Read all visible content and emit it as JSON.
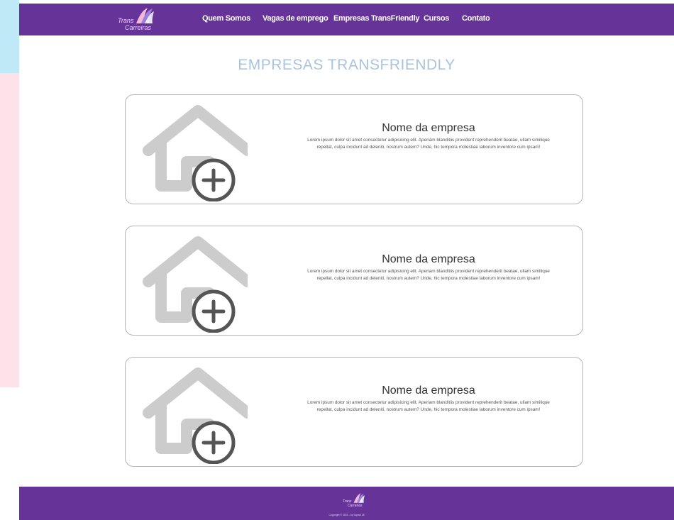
{
  "brand": {
    "line1": "Trans",
    "line2": "Carreiras"
  },
  "nav": {
    "items": [
      {
        "label": "Quem Somos"
      },
      {
        "label": "Vagas de emprego"
      },
      {
        "label": "Empresas TransFriendly"
      },
      {
        "label": "Cursos"
      },
      {
        "label": "Contato"
      }
    ]
  },
  "page": {
    "title": "EMPRESAS TRANSFRIENDLY"
  },
  "companies": [
    {
      "name": "Nome da empresa",
      "description": "Lorem ipsum dolor sit amet consectetur adipisicing elit. Aperiam blanditiis provident reprehenderit beatae, ullam similique repellat, culpa incidunt ad deleniti, nostrum autem? Unde, hic tempora molestiae laborum inventore cum ipsam!"
    },
    {
      "name": "Nome da empresa",
      "description": "Lorem ipsum dolor sit amet consectetur adipisicing elit. Aperiam blanditiis provident reprehenderit beatae, ullam similique repellat, culpa incidunt ad deleniti, nostrum autem? Unde, hic tempora molestiae laborum inventore cum ipsam!"
    },
    {
      "name": "Nome da empresa",
      "description": "Lorem ipsum dolor sit amet consectetur adipisicing elit. Aperiam blanditiis provident reprehenderit beatae, ullam similique repellat, culpa incidunt ad deleniti, nostrum autem? Unde, hic tempora molestiae laborum inventore cum ipsam!"
    }
  ],
  "footer": {
    "brand": {
      "line1": "Trans",
      "line2": "Carreiras"
    },
    "copyright": "Copyright © 2023 - by Squad 18"
  },
  "icons": {
    "logo": "ribbon-logo-icon",
    "company": "house-add-icon"
  },
  "colors": {
    "primary": "#663399",
    "title": "#aac4dc",
    "side_blue": "#bfe9f7",
    "side_pink": "#fde3e9",
    "icon_gray": "#cccccc",
    "icon_dark": "#555555"
  }
}
